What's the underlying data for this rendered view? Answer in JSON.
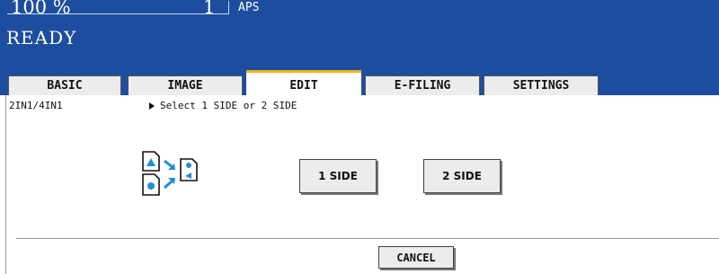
{
  "status": {
    "zoom": "100 %",
    "copies": "1",
    "paper_mode": "APS",
    "state": "READY"
  },
  "tabs": [
    {
      "label": "BASIC",
      "active": false
    },
    {
      "label": "IMAGE",
      "active": false
    },
    {
      "label": "EDIT",
      "active": true
    },
    {
      "label": "E-FILING",
      "active": false
    },
    {
      "label": "SETTINGS",
      "active": false
    }
  ],
  "content": {
    "title": "2IN1/4IN1",
    "instruction": "Select 1 SIDE or 2 SIDE",
    "icon": "2in1-layout-icon",
    "option_1_label": "1 SIDE",
    "option_2_label": "2 SIDE"
  },
  "footer": {
    "cancel_label": "CANCEL"
  },
  "colors": {
    "header_bg": "#1d4d9e",
    "active_tab_accent": "#f0b020",
    "icon_blue": "#1e90d6"
  }
}
